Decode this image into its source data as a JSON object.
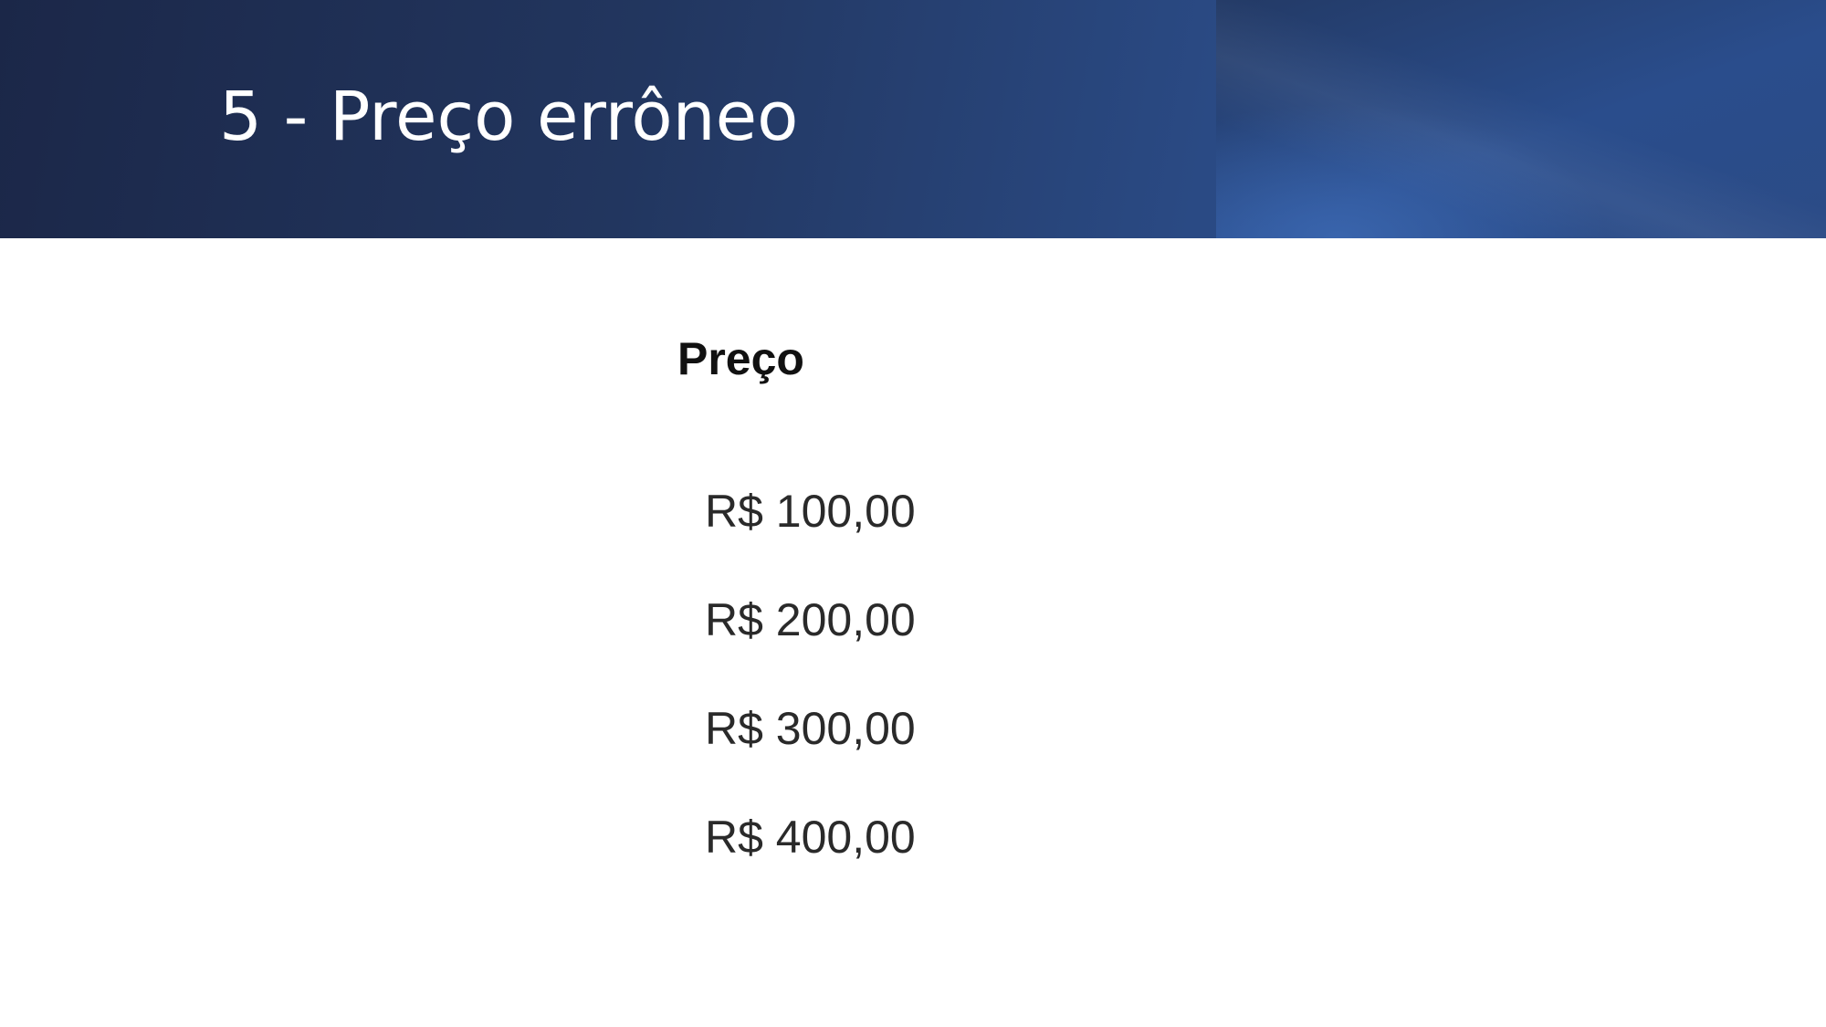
{
  "slide": {
    "title": "5 - Preço errôneo",
    "colors": {
      "header_dark": "#1b2748",
      "header_light": "#2d4f8a",
      "title_text": "#ffffff",
      "body_background": "#ffffff"
    }
  },
  "price_table": {
    "header": "Preço",
    "rows": [
      "R$ 100,00",
      "R$ 200,00",
      "R$ 300,00",
      "R$ 400,00"
    ]
  }
}
